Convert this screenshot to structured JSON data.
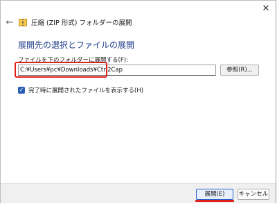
{
  "window": {
    "title": "圧縮 (ZIP 形式) フォルダーの展開",
    "close_glyph": "✕",
    "back_glyph": "←",
    "icons": [
      "back-arrow-icon",
      "zip-folder-icon",
      "close-icon",
      "checkmark-icon"
    ]
  },
  "main": {
    "heading": "展開先の選択とファイルの展開",
    "destination_label": "ファイルを下のフォルダーに展開する(F):",
    "destination_value": "C:¥Users¥pc¥Downloads¥Ctrl2Cap",
    "browse_label": "参照(R)...",
    "show_files_checked": true,
    "show_files_label": "完了時に展開されたファイルを表示する(H)",
    "check_glyph": "✓"
  },
  "footer": {
    "extract_label": "展開(E)",
    "cancel_label": "キャンセル"
  },
  "colors": {
    "heading": "#1f3d8a",
    "highlight": "#e0211b",
    "checkbox": "#2a5fb8",
    "primary_border": "#2a62c9"
  }
}
